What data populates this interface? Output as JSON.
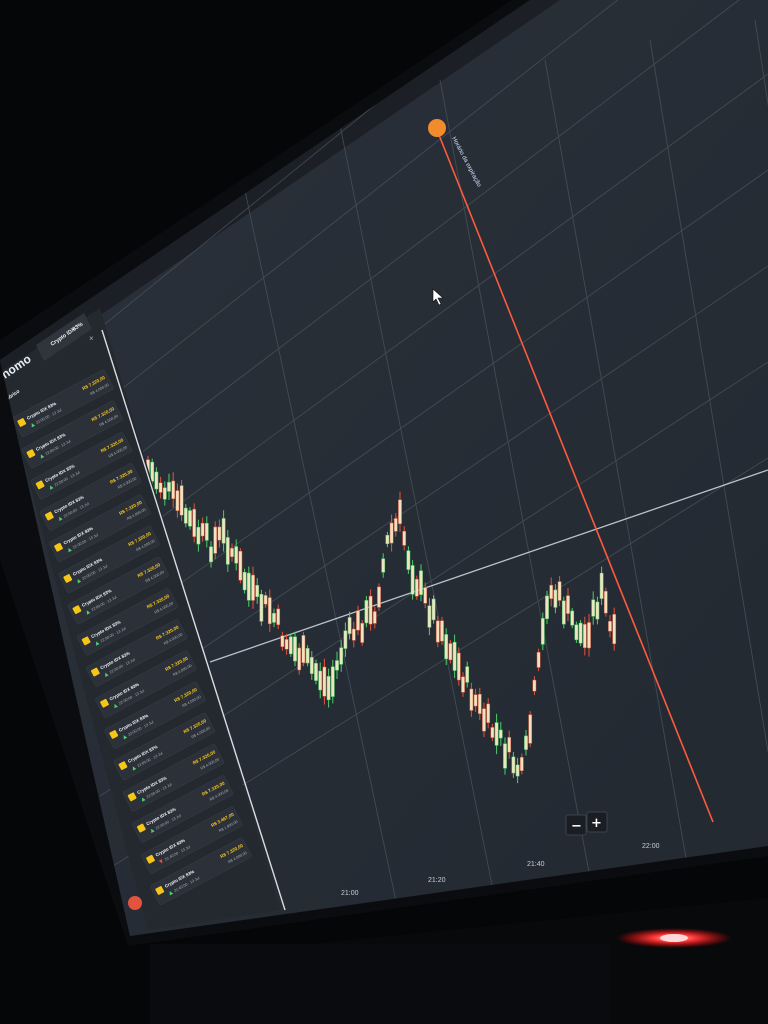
{
  "app": {
    "brand": "binomo",
    "active_tab": "Crypto IDX",
    "active_tab_percent": "83%"
  },
  "sidebar": {
    "title": "Histórico",
    "trades": [
      {
        "asset": "Crypto IDX 83%",
        "time": "22:00:00",
        "date": "13 Jul",
        "direction": "up",
        "payout": "R$ 7.320,00",
        "amount": "R$ 4.000,00"
      },
      {
        "asset": "Crypto IDX 83%",
        "time": "22:00:00",
        "date": "13 Jul",
        "direction": "up",
        "payout": "R$ 7.320,00",
        "amount": "R$ 4.000,00"
      },
      {
        "asset": "Crypto IDX 83%",
        "time": "22:00:00",
        "date": "13 Jul",
        "direction": "up",
        "payout": "R$ 7.320,00",
        "amount": "R$ 4.000,00"
      },
      {
        "asset": "Crypto IDX 83%",
        "time": "22:00:00",
        "date": "13 Jul",
        "direction": "up",
        "payout": "R$ 7.320,00",
        "amount": "R$ 4.000,00"
      },
      {
        "asset": "Crypto IDX 83%",
        "time": "22:00:00",
        "date": "13 Jul",
        "direction": "up",
        "payout": "R$ 7.320,00",
        "amount": "R$ 4.000,00"
      },
      {
        "asset": "Crypto IDX 83%",
        "time": "22:00:00",
        "date": "13 Jul",
        "direction": "up",
        "payout": "R$ 7.320,00",
        "amount": "R$ 4.000,00"
      },
      {
        "asset": "Crypto IDX 83%",
        "time": "22:00:00",
        "date": "13 Jul",
        "direction": "up",
        "payout": "R$ 7.320,00",
        "amount": "R$ 4.000,00"
      },
      {
        "asset": "Crypto IDX 83%",
        "time": "22:00:00",
        "date": "13 Jul",
        "direction": "up",
        "payout": "R$ 7.320,00",
        "amount": "R$ 4.000,00"
      },
      {
        "asset": "Crypto IDX 83%",
        "time": "22:00:00",
        "date": "13 Jul",
        "direction": "up",
        "payout": "R$ 7.320,00",
        "amount": "R$ 4.000,00"
      },
      {
        "asset": "Crypto IDX 83%",
        "time": "22:00:00",
        "date": "13 Jul",
        "direction": "up",
        "payout": "R$ 7.320,00",
        "amount": "R$ 4.000,00"
      },
      {
        "asset": "Crypto IDX 83%",
        "time": "22:00:00",
        "date": "13 Jul",
        "direction": "up",
        "payout": "R$ 7.320,00",
        "amount": "R$ 4.000,00"
      },
      {
        "asset": "Crypto IDX 83%",
        "time": "22:00:00",
        "date": "13 Jul",
        "direction": "up",
        "payout": "R$ 7.320,00",
        "amount": "R$ 4.000,00"
      },
      {
        "asset": "Crypto IDX 83%",
        "time": "22:00:00",
        "date": "13 Jul",
        "direction": "up",
        "payout": "R$ 7.320,00",
        "amount": "R$ 4.000,00"
      },
      {
        "asset": "Crypto IDX 83%",
        "time": "22:00:00",
        "date": "13 Jul",
        "direction": "up",
        "payout": "R$ 7.320,00",
        "amount": "R$ 4.000,00"
      },
      {
        "asset": "Crypto IDX 83%",
        "time": "21:40:00",
        "date": "13 Jul",
        "direction": "down",
        "payout": "R$ 3.467,00",
        "amount": "R$ 1.900,00"
      },
      {
        "asset": "Crypto IDX 83%",
        "time": "21:40:00",
        "date": "13 Jul",
        "direction": "up",
        "payout": "R$ 7.320,00",
        "amount": "R$ 4.000,00"
      }
    ]
  },
  "chart": {
    "time_labels": [
      "21:00",
      "21:20",
      "21:40",
      "22:00"
    ],
    "expiry_label": "Horário da expiração",
    "zoom_out_label": "−",
    "zoom_in_label": "+",
    "up_color": "#4cd06a",
    "down_color": "#e2543d",
    "candle_body_color": "#efe3c0",
    "expiry_color": "#ff5a3c",
    "price_line_color": "#dfe8f2"
  },
  "monitor": {
    "power_led_color": "#ff2a2a"
  }
}
